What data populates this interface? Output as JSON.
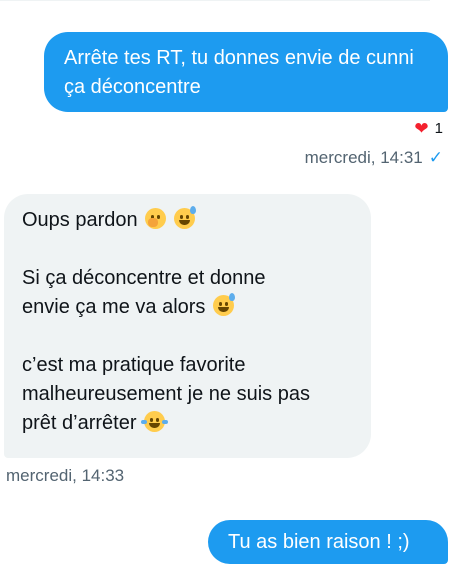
{
  "conversation": {
    "messages": [
      {
        "direction": "outgoing",
        "text": "Arrête tes RT, tu donnes envie de cunni ça déconcentre",
        "reaction": {
          "emoji": "❤",
          "count": "1"
        },
        "timestamp": "mercredi, 14:31",
        "status_icon": "check-icon"
      },
      {
        "direction": "incoming",
        "paragraphs": [
          {
            "text": "Oups pardon",
            "emojis": [
              "hand-over-mouth-emoji",
              "grinning-sweat-emoji"
            ]
          },
          {
            "text": "Si ça déconcentre et donne\nenvie ça me va alors",
            "emojis": [
              "grinning-sweat-emoji"
            ]
          },
          {
            "text": "c’est ma pratique favorite\nmalheureusement je ne suis pas\nprêt d’arrêter",
            "emojis": [
              "tears-of-joy-emoji"
            ]
          }
        ],
        "timestamp": "mercredi, 14:33"
      },
      {
        "direction": "outgoing",
        "text": "Tu as bien raison ! ;)"
      }
    ]
  },
  "colors": {
    "outgoing_bubble": "#1d9bf0",
    "incoming_bubble": "#eff3f4",
    "meta_text": "#536471",
    "heart": "#f4212e"
  }
}
